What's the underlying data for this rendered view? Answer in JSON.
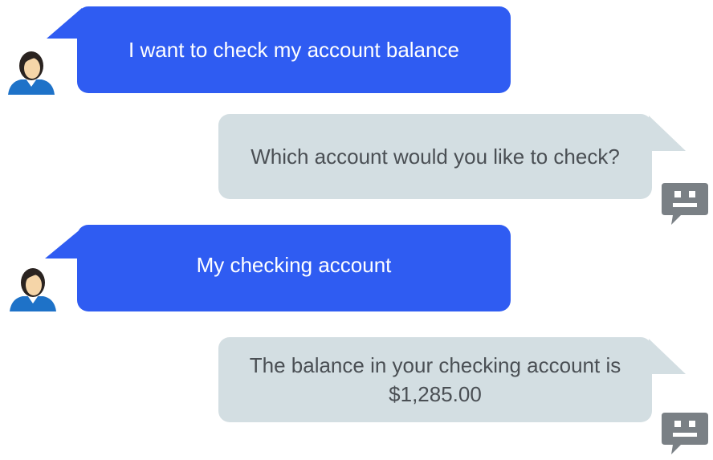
{
  "conversation": {
    "messages": [
      {
        "sender": "user",
        "text": "I want to check my account balance",
        "avatar_icon": "user-avatar-icon"
      },
      {
        "sender": "bot",
        "text": "Which account would you like to check?",
        "avatar_icon": "chatbot-icon"
      },
      {
        "sender": "user",
        "text": "My checking account",
        "avatar_icon": "user-avatar-icon"
      },
      {
        "sender": "bot",
        "text": "The balance in your checking account is $1,285.00",
        "avatar_icon": "chatbot-icon"
      }
    ]
  },
  "colors": {
    "user_bubble": "#2f5cf2",
    "bot_bubble": "#d3dee2",
    "user_text": "#ffffff",
    "bot_text": "#4a4f54",
    "bot_icon": "#7a8085",
    "avatar_shirt": "#1e72c8",
    "avatar_skin": "#f5d5a8",
    "avatar_hair": "#2a2320"
  }
}
